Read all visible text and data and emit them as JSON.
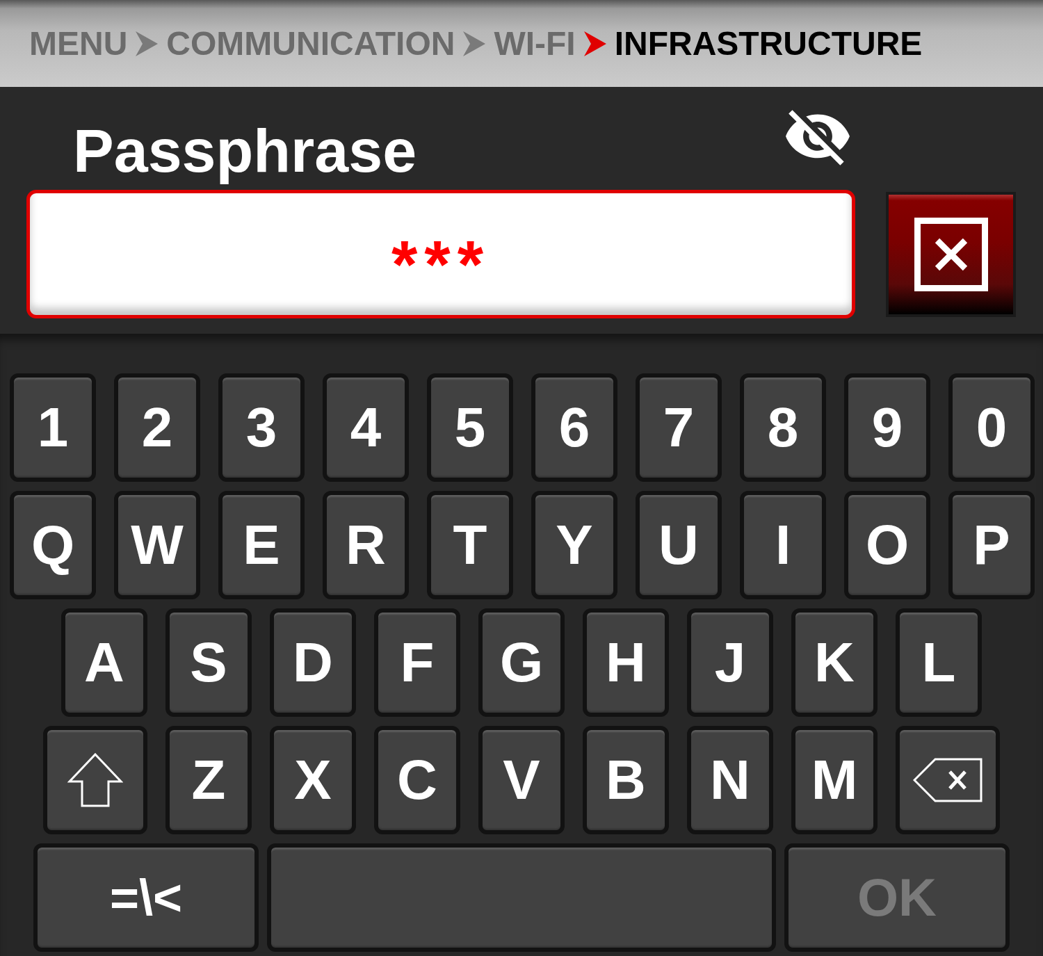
{
  "breadcrumb": [
    {
      "label": "MENU",
      "current": false
    },
    {
      "label": "COMMUNICATION",
      "current": false
    },
    {
      "label": "WI-FI",
      "current": false
    },
    {
      "label": "INFRASTRUCTURE",
      "current": true
    }
  ],
  "field": {
    "label": "Passphrase",
    "value": "***",
    "revealed": false
  },
  "keyboard": {
    "rows": [
      {
        "keys": [
          {
            "kind": "char",
            "label": "1"
          },
          {
            "kind": "char",
            "label": "2"
          },
          {
            "kind": "char",
            "label": "3"
          },
          {
            "kind": "char",
            "label": "4"
          },
          {
            "kind": "char",
            "label": "5"
          },
          {
            "kind": "char",
            "label": "6"
          },
          {
            "kind": "char",
            "label": "7"
          },
          {
            "kind": "char",
            "label": "8"
          },
          {
            "kind": "char",
            "label": "9"
          },
          {
            "kind": "char",
            "label": "0"
          }
        ]
      },
      {
        "keys": [
          {
            "kind": "char",
            "label": "Q"
          },
          {
            "kind": "char",
            "label": "W"
          },
          {
            "kind": "char",
            "label": "E"
          },
          {
            "kind": "char",
            "label": "R"
          },
          {
            "kind": "char",
            "label": "T"
          },
          {
            "kind": "char",
            "label": "Y"
          },
          {
            "kind": "char",
            "label": "U"
          },
          {
            "kind": "char",
            "label": "I"
          },
          {
            "kind": "char",
            "label": "O"
          },
          {
            "kind": "char",
            "label": "P"
          }
        ]
      },
      {
        "keys": [
          {
            "kind": "char",
            "label": "A"
          },
          {
            "kind": "char",
            "label": "S"
          },
          {
            "kind": "char",
            "label": "D"
          },
          {
            "kind": "char",
            "label": "F"
          },
          {
            "kind": "char",
            "label": "G"
          },
          {
            "kind": "char",
            "label": "H"
          },
          {
            "kind": "char",
            "label": "J"
          },
          {
            "kind": "char",
            "label": "K"
          },
          {
            "kind": "char",
            "label": "L"
          }
        ]
      },
      {
        "keys": [
          {
            "kind": "shift"
          },
          {
            "kind": "char",
            "label": "Z"
          },
          {
            "kind": "char",
            "label": "X"
          },
          {
            "kind": "char",
            "label": "C"
          },
          {
            "kind": "char",
            "label": "V"
          },
          {
            "kind": "char",
            "label": "B"
          },
          {
            "kind": "char",
            "label": "N"
          },
          {
            "kind": "char",
            "label": "M"
          },
          {
            "kind": "backspace"
          }
        ]
      },
      {
        "keys": [
          {
            "kind": "symbols",
            "label": "=\\<"
          },
          {
            "kind": "space"
          },
          {
            "kind": "ok",
            "label": "OK",
            "disabled": true
          }
        ]
      }
    ]
  }
}
